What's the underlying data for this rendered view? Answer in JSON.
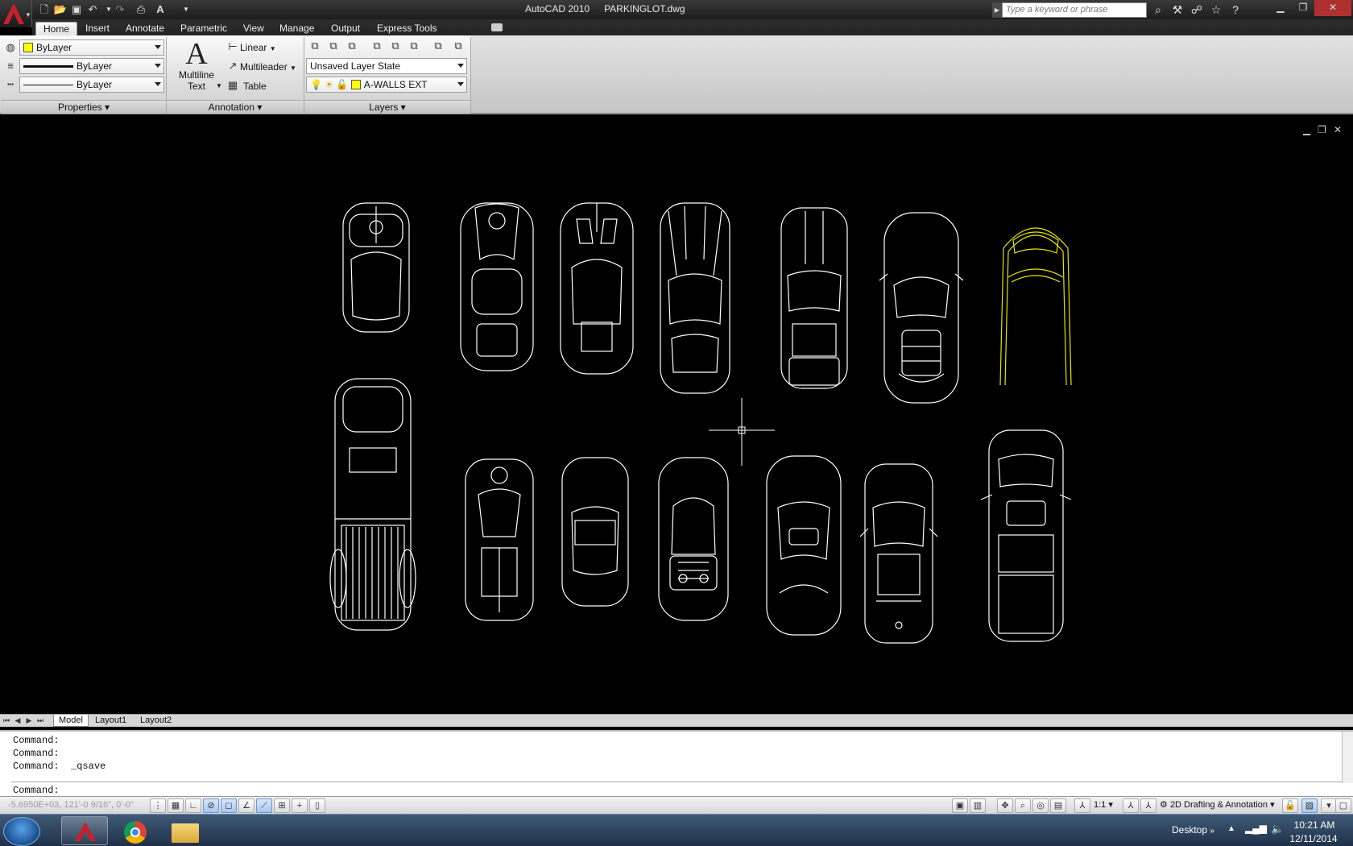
{
  "titlebar": {
    "app_name": "AutoCAD 2010",
    "file_name": "PARKINGLOT.dwg",
    "search_placeholder": "Type a keyword or phrase"
  },
  "ribbon_tabs": [
    "Home",
    "Insert",
    "Annotate",
    "Parametric",
    "View",
    "Manage",
    "Output",
    "Express Tools"
  ],
  "active_tab": "Home",
  "properties_panel": {
    "color_value": "ByLayer",
    "lineweight_value": "ByLayer",
    "linetype_value": "ByLayer",
    "title": "Properties"
  },
  "annotation_panel": {
    "multiline_text_line1": "Multiline",
    "multiline_text_line2": "Text",
    "linear_label": "Linear",
    "multileader_label": "Multileader",
    "table_label": "Table",
    "title": "Annotation"
  },
  "layers_panel": {
    "layer_state": "Unsaved Layer State",
    "current_layer": "A-WALLS EXT",
    "title": "Layers"
  },
  "layout_tabs": [
    "Model",
    "Layout1",
    "Layout2"
  ],
  "active_layout": "Model",
  "command_history": [
    "Command:",
    "Command:",
    "Command:  _qsave"
  ],
  "command_prompt": "Command:",
  "statusbar": {
    "coordinates": "-5.6950E+03, 121'-0 9/16\", 0'-0\"",
    "annotation_scale": "1:1",
    "workspace": "2D Drafting & Annotation"
  },
  "taskbar": {
    "desktop_label": "Desktop",
    "time": "10:21 AM",
    "date": "12/11/2014"
  },
  "colors": {
    "layer_color": "#ffff00",
    "drawing_background": "#000000",
    "selected_vehicle": "#e6e600",
    "vehicle_lines": "#ffffff"
  }
}
